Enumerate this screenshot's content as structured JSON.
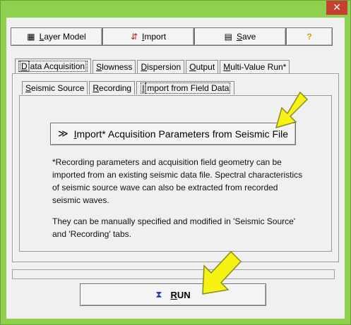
{
  "window": {
    "close_glyph": "✕",
    "close_icon": "close-icon"
  },
  "toolbar": {
    "layer_model": {
      "icon": "layer-model-icon",
      "glyph": "▦",
      "label_u": "L",
      "label_rest": "ayer Model"
    },
    "import": {
      "icon": "import-icon",
      "glyph": "⇵",
      "label_u": "I",
      "label_rest": "mport"
    },
    "save": {
      "icon": "save-icon",
      "glyph": "▤",
      "label_u": "S",
      "label_rest": "ave"
    },
    "help": {
      "label": "?",
      "color": "#d4a000"
    }
  },
  "tabs": [
    {
      "u": "D",
      "rest": "ata Acquisition",
      "active": true
    },
    {
      "u": "S",
      "rest": "lowness"
    },
    {
      "u": "D",
      "rest": "ispersion"
    },
    {
      "u": "O",
      "rest": "utput"
    },
    {
      "u": "M",
      "rest": "ulti-Value Run*"
    }
  ],
  "subtabs": [
    {
      "u": "S",
      "rest": "eismic Source"
    },
    {
      "u": "R",
      "rest": "ecording"
    },
    {
      "u": "I",
      "rest": "mport from Field Data",
      "active": true
    }
  ],
  "import_button": {
    "icon": "seismic-wave-icon",
    "glyph": "≫",
    "u": "I",
    "rest": "mport* Acquisition Parameters from Seismic File"
  },
  "description": {
    "p1": "*Recording parameters and acquisition field geometry can be imported from an existing seismic data file.  Spectral characteristics of seismic source wave can also be extracted from recorded seismic waves.",
    "p2": "They can be manually specified and modified in 'Seismic Source' and 'Recording' tabs."
  },
  "run_button": {
    "icon": "hourglass-icon",
    "glyph": "⧗",
    "u": "R",
    "rest": "UN"
  },
  "colors": {
    "frame": "#8fd14f",
    "close": "#c7402f",
    "arrow_fill": "#f6f314",
    "arrow_stroke": "#8a8a20"
  }
}
